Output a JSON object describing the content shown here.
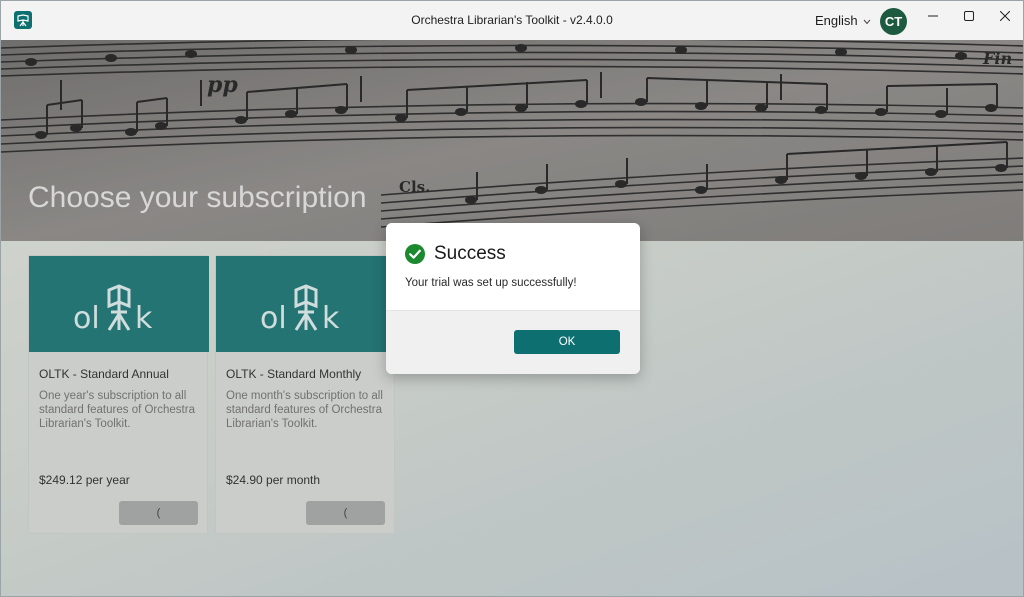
{
  "window": {
    "title": "Orchestra Librarian's Toolkit - v2.4.0.0",
    "language": "English",
    "avatar_initials": "CT"
  },
  "banner": {
    "title": "Choose your subscription",
    "score_text": {
      "dynamic": "pp",
      "instrument": "Cls.",
      "tempo": "Fin"
    }
  },
  "logo_text": {
    "left": "ol",
    "right": "k"
  },
  "products": [
    {
      "name": "OLTK - Standard Annual",
      "description": "One year's subscription to all standard features of Orchestra Librarian's Toolkit.",
      "price": "$249.12 per year",
      "button_label": "("
    },
    {
      "name": "OLTK - Standard Monthly",
      "description": "One month's subscription to all standard features of Orchestra Librarian's Toolkit.",
      "price": "$24.90 per month",
      "button_label": "("
    }
  ],
  "dialog": {
    "title": "Success",
    "message": "Your trial was set up successfully!",
    "ok_label": "OK",
    "icon": "check-circle-icon"
  },
  "colors": {
    "accent": "#0e6f70",
    "success": "#1b8a2f",
    "avatar": "#1e5a40"
  }
}
